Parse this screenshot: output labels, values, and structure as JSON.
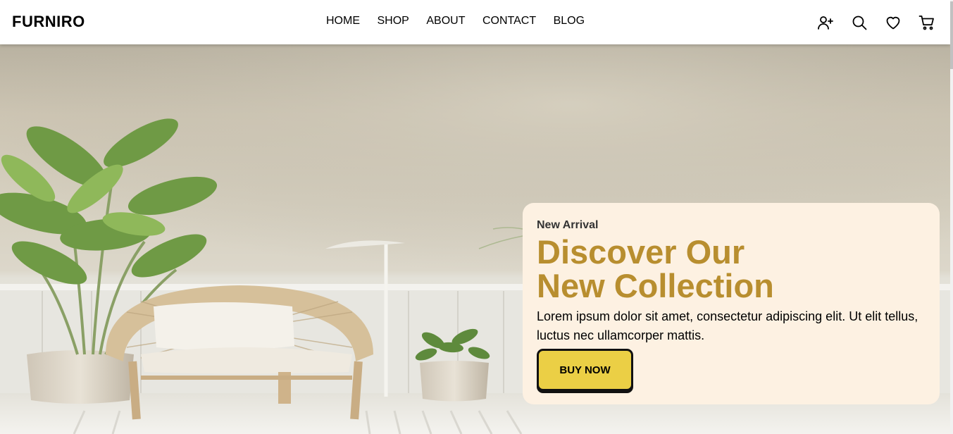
{
  "brand": {
    "name": "FURNIRO"
  },
  "nav": {
    "items": [
      {
        "label": "HOME"
      },
      {
        "label": "SHOP"
      },
      {
        "label": "ABOUT"
      },
      {
        "label": "CONTACT"
      },
      {
        "label": "BLOG"
      }
    ]
  },
  "header_icons": [
    "add-user-icon",
    "search-icon",
    "heart-icon",
    "cart-icon"
  ],
  "hero": {
    "eyebrow": "New Arrival",
    "title_line1": "Discover Our",
    "title_line2": "New Collection",
    "description": "Lorem ipsum dolor sit amet, consectetur adipiscing elit. Ut elit tellus, luctus nec ullamcorper mattis.",
    "cta_label": "BUY NOW"
  },
  "colors": {
    "accent": "#b88e2f",
    "card_background": "#fdf1e2",
    "button": "#ebcf45"
  }
}
